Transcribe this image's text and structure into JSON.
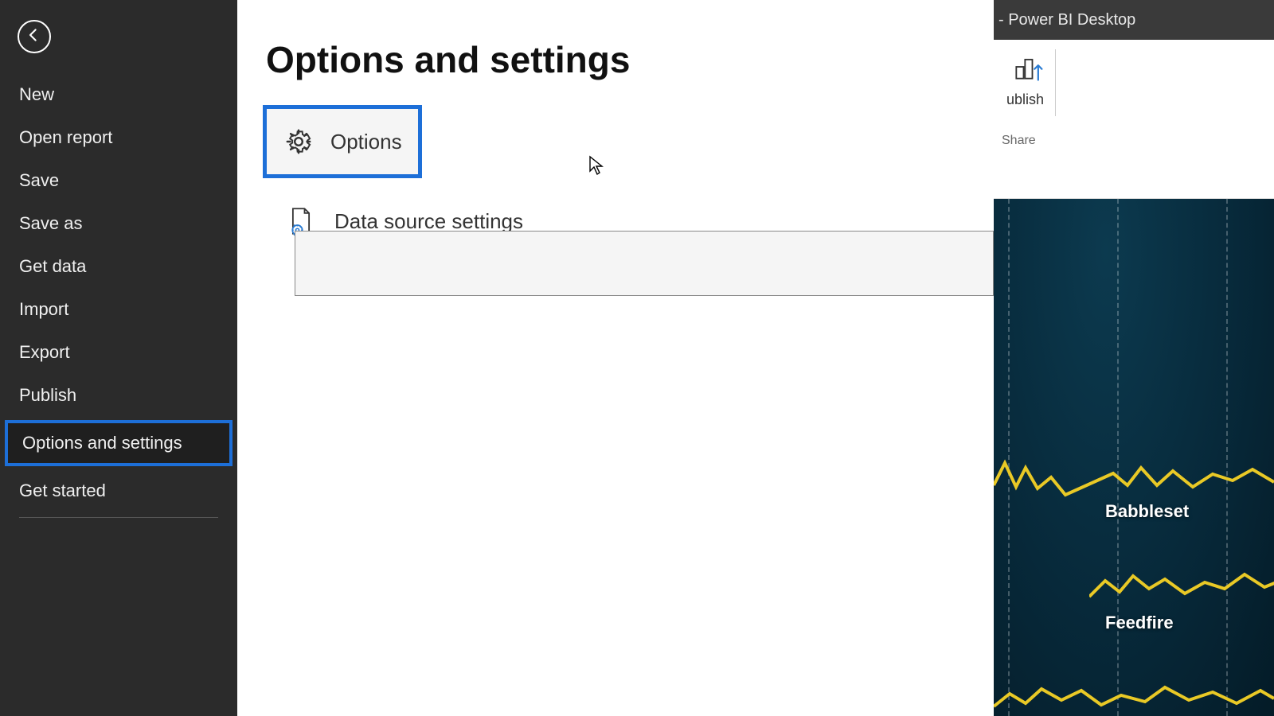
{
  "app": {
    "window_title_fragment": "- Power BI Desktop"
  },
  "sidebar": {
    "items": [
      {
        "label": "New"
      },
      {
        "label": "Open report"
      },
      {
        "label": "Save"
      },
      {
        "label": "Save as"
      },
      {
        "label": "Get data"
      },
      {
        "label": "Import"
      },
      {
        "label": "Export"
      },
      {
        "label": "Publish"
      },
      {
        "label": "Options and settings",
        "highlighted": true
      },
      {
        "label": "Get started"
      }
    ]
  },
  "main": {
    "title": "Options and settings",
    "rows": [
      {
        "label": "Options",
        "icon": "gear-icon",
        "highlighted": true
      },
      {
        "label": "Data source settings",
        "icon": "document-gear-icon"
      }
    ]
  },
  "ribbon": {
    "button_label": "ublish",
    "group_label": "Share"
  },
  "report": {
    "series": [
      {
        "label": "Babbleset"
      },
      {
        "label": "Feedfire"
      }
    ]
  },
  "colors": {
    "highlight": "#1d6fd8",
    "sidebar_bg": "#2b2b2b",
    "spark": "#e9c926"
  }
}
